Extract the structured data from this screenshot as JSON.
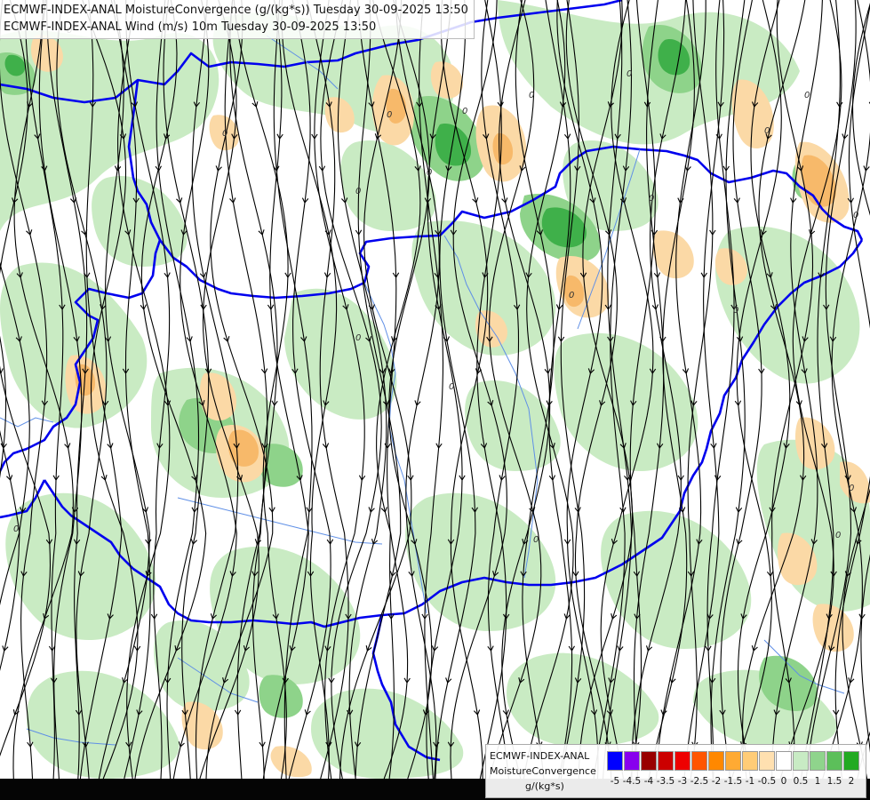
{
  "titles": {
    "line1": "ECMWF-INDEX-ANAL MoistureConvergence (g/(kg*s)) Tuesday 30-09-2025 13:50",
    "line2": "ECMWF-INDEX-ANAL Wind (m/s) 10m Tuesday 30-09-2025 13:50"
  },
  "legend": {
    "source": "ECMWF-INDEX-ANAL",
    "variable": "MoistureConvergence",
    "unit": "g/(kg*s)",
    "tick_labels": [
      "-5",
      "-4.5",
      "-4",
      "-3.5",
      "-3",
      "-2.5",
      "-2",
      "-1.5",
      "-1",
      "-0.5",
      "0",
      "0.5",
      "1",
      "1.5",
      "2"
    ],
    "colors": [
      "#0000ff",
      "#8800ee",
      "#990000",
      "#cc0000",
      "#ee0000",
      "#ff5500",
      "#ff8800",
      "#ffaa33",
      "#ffcc77",
      "#ffe0b0",
      "#ffffff",
      "#c8ebc4",
      "#8fd48c",
      "#5cbf5a",
      "#22aa22"
    ]
  },
  "map": {
    "contour_label": "0",
    "colors": {
      "background": "#ffffff",
      "light_green": "#c9ebc3",
      "mid_green": "#8ed38a",
      "dark_green": "#3fb04a",
      "light_orange": "#fbd9a6",
      "mid_orange": "#f7b96a",
      "streamline": "#000000",
      "border": "#0000ee",
      "river": "#5f8fe6"
    }
  }
}
